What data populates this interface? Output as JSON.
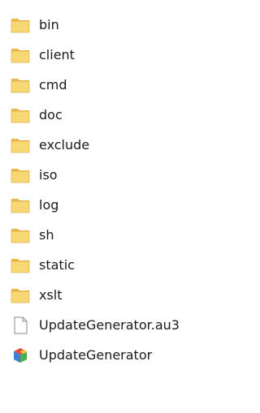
{
  "items": [
    {
      "name": "bin",
      "type": "folder",
      "icon": "folder-icon"
    },
    {
      "name": "client",
      "type": "folder",
      "icon": "folder-icon"
    },
    {
      "name": "cmd",
      "type": "folder",
      "icon": "folder-icon"
    },
    {
      "name": "doc",
      "type": "folder",
      "icon": "folder-icon"
    },
    {
      "name": "exclude",
      "type": "folder",
      "icon": "folder-icon"
    },
    {
      "name": "iso",
      "type": "folder",
      "icon": "folder-icon"
    },
    {
      "name": "log",
      "type": "folder",
      "icon": "folder-icon"
    },
    {
      "name": "sh",
      "type": "folder",
      "icon": "folder-icon"
    },
    {
      "name": "static",
      "type": "folder",
      "icon": "folder-icon"
    },
    {
      "name": "xslt",
      "type": "folder",
      "icon": "folder-icon"
    },
    {
      "name": "UpdateGenerator.au3",
      "type": "file",
      "icon": "file-icon"
    },
    {
      "name": "UpdateGenerator",
      "type": "application",
      "icon": "application-icon"
    }
  ],
  "colors": {
    "folder_front": "#F8D775",
    "folder_back": "#E8B84A",
    "folder_edge": "#D9A63A",
    "text": "#1a1a1a"
  }
}
